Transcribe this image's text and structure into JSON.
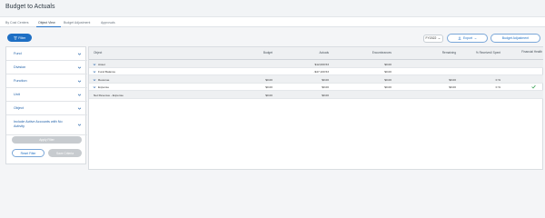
{
  "page": {
    "title": "Budget to Actuals"
  },
  "tabs": [
    {
      "label": "By Cost Centers"
    },
    {
      "label": "Object View"
    },
    {
      "label": "Budget Adjustment"
    },
    {
      "label": "Approvals"
    }
  ],
  "toolbar": {
    "filter_label": "Filter",
    "fiscal_year": "FY2022",
    "export_label": "Export",
    "budget_adjustment_label": "Budget Adjustment"
  },
  "filters": {
    "items": [
      "Fund",
      "Division",
      "Function",
      "Unit",
      "Object"
    ],
    "include_inactive": "Include Active Accounts with No Activity",
    "apply_label": "Apply Filter",
    "reset_label": "Reset Filter",
    "save_label": "Save Criteria"
  },
  "table": {
    "headers": [
      "Object",
      "Budget",
      "Actuals",
      "Encumbrances",
      "Remaining",
      "% Received/ Spent",
      "Financial Health"
    ],
    "rows": [
      {
        "object": "Asset",
        "budget": "",
        "actuals": "$12,000.53",
        "encumbrances": "$0.00",
        "remaining": "",
        "percent": "",
        "health": ""
      },
      {
        "object": "Fund Balance",
        "budget": "",
        "actuals": "-$47,100.53",
        "encumbrances": "$0.00",
        "remaining": "",
        "percent": "",
        "health": ""
      },
      {
        "object": "Revenue",
        "budget": "$0.00",
        "actuals": "$0.00",
        "encumbrances": "$0.00",
        "remaining": "$0.00",
        "percent": "0 %",
        "health": ""
      },
      {
        "object": "Expense",
        "budget": "$0.00",
        "actuals": "$0.00",
        "encumbrances": "$0.00",
        "remaining": "$0.00",
        "percent": "0 %",
        "health": "check"
      },
      {
        "object": "Net Revenue - Expense",
        "budget": "$0.00",
        "actuals": "$0.00",
        "encumbrances": "",
        "remaining": "",
        "percent": "",
        "health": ""
      }
    ]
  },
  "colors": {
    "accent": "#1e6fc4",
    "success": "#2e9d4c"
  }
}
